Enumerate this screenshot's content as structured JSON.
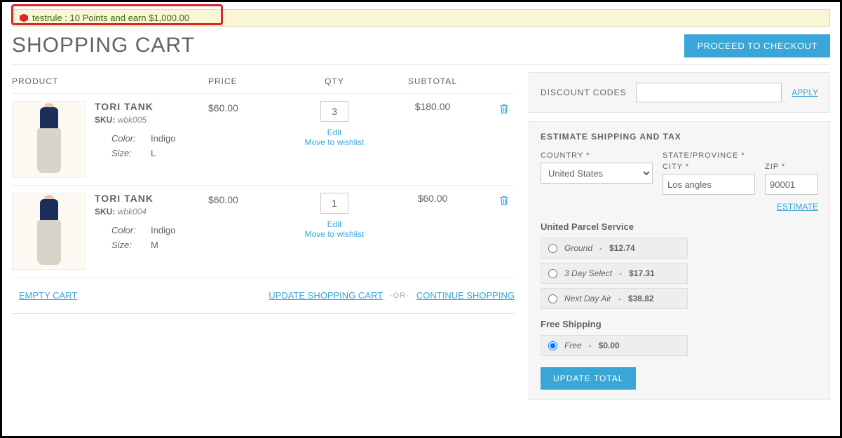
{
  "notice": {
    "text": "testrule : 10 Points and earn $1,000.00"
  },
  "page_title": "SHOPPING CART",
  "checkout_button": "PROCEED TO CHECKOUT",
  "columns": {
    "product": "PRODUCT",
    "price": "PRICE",
    "qty": "QTY",
    "subtotal": "SUBTOTAL"
  },
  "link_labels": {
    "edit": "Edit",
    "move_wishlist": "Move to wishlist"
  },
  "attr_labels": {
    "sku": "SKU:",
    "color": "Color:",
    "size": "Size:"
  },
  "items": [
    {
      "name": "TORI TANK",
      "sku": "wbk005",
      "color": "Indigo",
      "size": "L",
      "price": "$60.00",
      "qty": "3",
      "subtotal": "$180.00"
    },
    {
      "name": "TORI TANK",
      "sku": "wbk004",
      "color": "Indigo",
      "size": "M",
      "price": "$60.00",
      "qty": "1",
      "subtotal": "$60.00"
    }
  ],
  "actions": {
    "empty_cart": "EMPTY CART",
    "update_cart": "UPDATE SHOPPING CART",
    "or": "-OR-",
    "continue": "CONTINUE SHOPPING"
  },
  "discount": {
    "label": "DISCOUNT CODES",
    "value": "",
    "apply": "APPLY"
  },
  "shipping": {
    "title": "ESTIMATE SHIPPING AND TAX",
    "country_label": "COUNTRY",
    "state_label": "STATE/PROVINCE",
    "city_label": "CITY",
    "zip_label": "ZIP",
    "country": "United States",
    "city": "Los angles",
    "zip": "90001",
    "estimate": "ESTIMATE",
    "groups": [
      {
        "title": "United Parcel Service",
        "options": [
          {
            "name": "Ground",
            "price": "$12.74",
            "selected": false
          },
          {
            "name": "3 Day Select",
            "price": "$17.31",
            "selected": false
          },
          {
            "name": "Next Day Air",
            "price": "$38.82",
            "selected": false
          }
        ]
      },
      {
        "title": "Free Shipping",
        "options": [
          {
            "name": "Free",
            "price": "$0.00",
            "selected": true
          }
        ]
      }
    ],
    "update_total": "UPDATE TOTAL"
  }
}
